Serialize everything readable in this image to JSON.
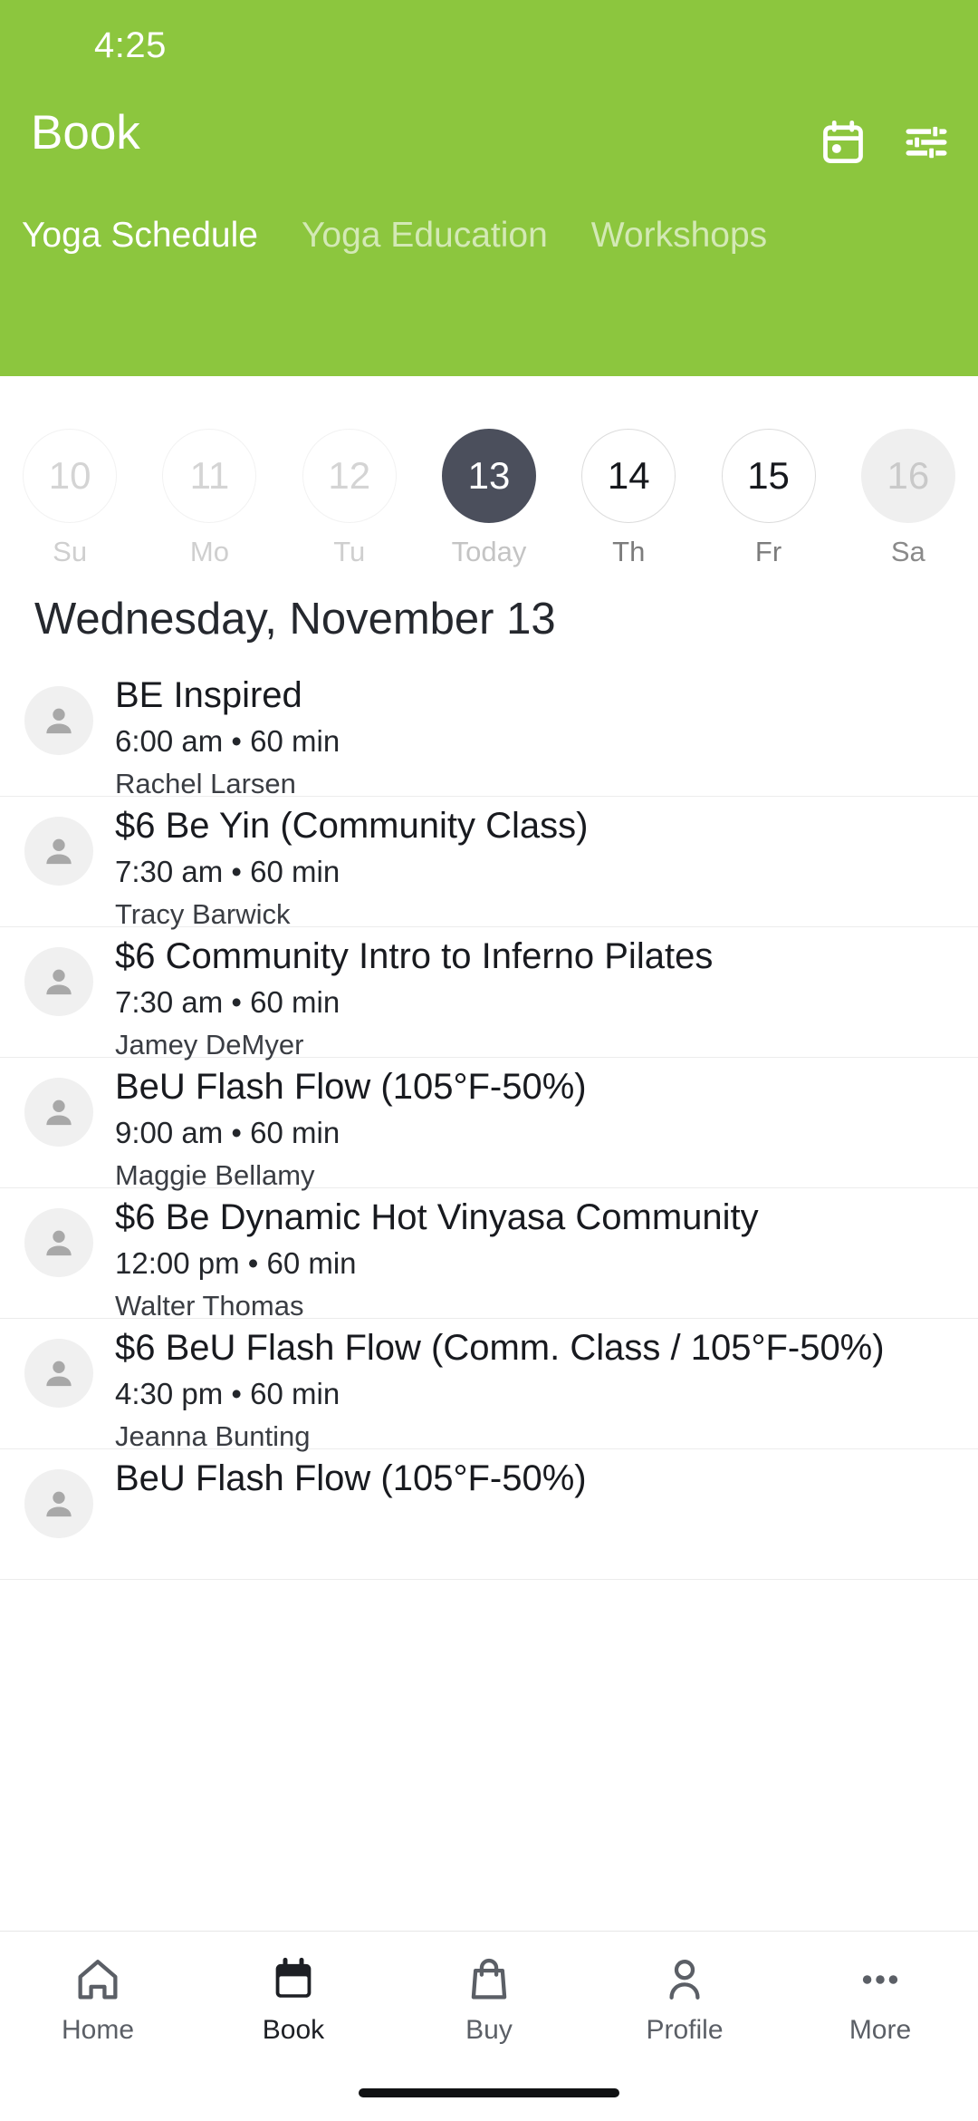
{
  "status_bar": {
    "time": "4:25"
  },
  "header": {
    "title": "Book",
    "background_color": "#8CC63E",
    "actions": [
      {
        "name": "calendar-icon",
        "label": "Calendar"
      },
      {
        "name": "filter-icon",
        "label": "Filters"
      }
    ],
    "tabs": [
      {
        "label": "Yoga Schedule",
        "active": true
      },
      {
        "label": "Yoga Education",
        "active": false
      },
      {
        "label": "Workshops",
        "active": false
      }
    ]
  },
  "date_strip": {
    "days": [
      {
        "number": "10",
        "label": "Su",
        "state": "past"
      },
      {
        "number": "11",
        "label": "Mo",
        "state": "past"
      },
      {
        "number": "12",
        "label": "Tu",
        "state": "past"
      },
      {
        "number": "13",
        "label": "Today",
        "state": "selected"
      },
      {
        "number": "14",
        "label": "Th",
        "state": "future"
      },
      {
        "number": "15",
        "label": "Fr",
        "state": "future"
      },
      {
        "number": "16",
        "label": "Sa",
        "state": "disabled"
      }
    ],
    "selected_color": "#4B4F5C"
  },
  "schedule": {
    "date_heading": "Wednesday, November 13",
    "classes": [
      {
        "title": "BE Inspired",
        "meta": "6:00 am • 60 min",
        "instructor": "Rachel Larsen"
      },
      {
        "title": "$6 Be Yin (Community Class)",
        "meta": "7:30 am • 60 min",
        "instructor": "Tracy Barwick"
      },
      {
        "title": "$6 Community Intro to Inferno Pilates",
        "meta": "7:30 am • 60 min",
        "instructor": "Jamey DeMyer"
      },
      {
        "title": "BeU Flash Flow (105°F-50%)",
        "meta": "9:00 am • 60 min",
        "instructor": "Maggie Bellamy"
      },
      {
        "title": "$6 Be Dynamic Hot Vinyasa Community",
        "meta": "12:00 pm • 60 min",
        "instructor": "Walter Thomas"
      },
      {
        "title": "$6 BeU Flash Flow (Comm. Class / 105°F-50%)",
        "meta": "4:30 pm • 60 min",
        "instructor": "Jeanna Bunting"
      },
      {
        "title": "BeU Flash Flow (105°F-50%)",
        "meta": "",
        "instructor": ""
      }
    ]
  },
  "bottom_nav": {
    "items": [
      {
        "label": "Home",
        "icon": "home-icon",
        "active": false
      },
      {
        "label": "Book",
        "icon": "calendar-icon",
        "active": true
      },
      {
        "label": "Buy",
        "icon": "shopping-bag-icon",
        "active": false
      },
      {
        "label": "Profile",
        "icon": "person-icon",
        "active": false
      },
      {
        "label": "More",
        "icon": "ellipsis-icon",
        "active": false
      }
    ]
  }
}
